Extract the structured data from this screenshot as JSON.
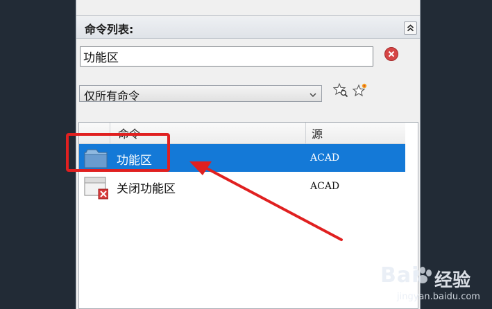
{
  "panel": {
    "header_title": "命令列表:",
    "collapse_glyph": "⌃",
    "search": {
      "value": "功能区"
    },
    "filter": {
      "selected": "仅所有命令"
    },
    "list": {
      "columns": [
        "命令",
        "源"
      ],
      "rows": [
        {
          "name": "功能区",
          "source": "ACAD",
          "selected": true,
          "icon": "ribbon-panel-icon"
        },
        {
          "name": "关闭功能区",
          "source": "ACAD",
          "selected": false,
          "icon": "close-ribbon-icon"
        }
      ]
    }
  },
  "colors": {
    "selection": "#1479d7",
    "annotation": "#e02020",
    "background": "#222b36"
  },
  "watermark": {
    "brand": "Bai",
    "brand_cn": "经验",
    "sub": "jingyan.baidu.com"
  }
}
